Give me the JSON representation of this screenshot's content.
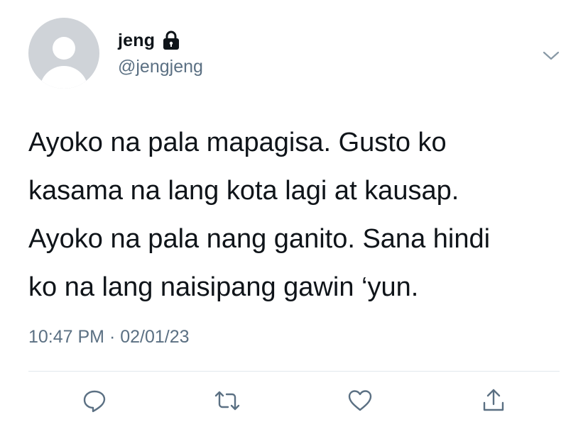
{
  "tweet": {
    "author": {
      "display_name": "jeng",
      "handle": "@jengjeng",
      "protected_icon": "lock-icon",
      "avatar_icon": "default-avatar"
    },
    "text_lines": [
      "Ayoko na pala mapagisa. Gusto ko",
      "kasama na lang kota lagi at kausap.",
      "Ayoko na pala nang ganito. Sana hindi",
      "ko na lang naisipang gawin ‘yun."
    ],
    "time": "10:47 PM",
    "separator": "·",
    "date": "02/01/23",
    "menu_icon": "chevron-down-icon",
    "actions": [
      {
        "name": "reply",
        "icon": "reply-icon"
      },
      {
        "name": "retweet",
        "icon": "retweet-icon"
      },
      {
        "name": "like",
        "icon": "heart-icon"
      },
      {
        "name": "share",
        "icon": "share-icon"
      }
    ],
    "colors": {
      "text": "#0f1419",
      "secondary": "#5b7083",
      "divider": "#e1e8ed",
      "avatar_bg": "#cfd3d8"
    }
  }
}
